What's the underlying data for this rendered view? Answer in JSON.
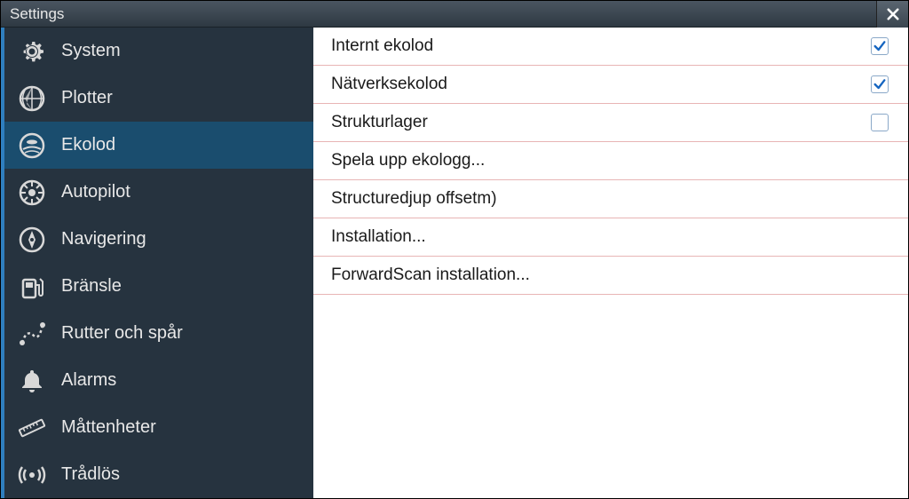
{
  "title": "Settings",
  "sidebar": {
    "items": [
      {
        "id": "system",
        "label": "System",
        "selected": false
      },
      {
        "id": "plotter",
        "label": "Plotter",
        "selected": false
      },
      {
        "id": "ekolod",
        "label": "Ekolod",
        "selected": true
      },
      {
        "id": "autopilot",
        "label": "Autopilot",
        "selected": false
      },
      {
        "id": "navigering",
        "label": "Navigering",
        "selected": false
      },
      {
        "id": "bransle",
        "label": "Bränsle",
        "selected": false
      },
      {
        "id": "rutter",
        "label": "Rutter och spår",
        "selected": false
      },
      {
        "id": "alarms",
        "label": "Alarms",
        "selected": false
      },
      {
        "id": "mattenheter",
        "label": "Måttenheter",
        "selected": false
      },
      {
        "id": "tradlos",
        "label": "Trådlös",
        "selected": false
      }
    ]
  },
  "content": {
    "rows": [
      {
        "label": "Internt ekolod",
        "type": "checkbox",
        "checked": true
      },
      {
        "label": "Nätverksekolod",
        "type": "checkbox",
        "checked": true
      },
      {
        "label": "Strukturlager",
        "type": "checkbox",
        "checked": false
      },
      {
        "label": "Spela upp ekologg...",
        "type": "action"
      },
      {
        "label": "Structuredjup offsetm)",
        "type": "action"
      },
      {
        "label": "Installation...",
        "type": "action"
      },
      {
        "label": "ForwardScan installation...",
        "type": "action"
      }
    ]
  }
}
